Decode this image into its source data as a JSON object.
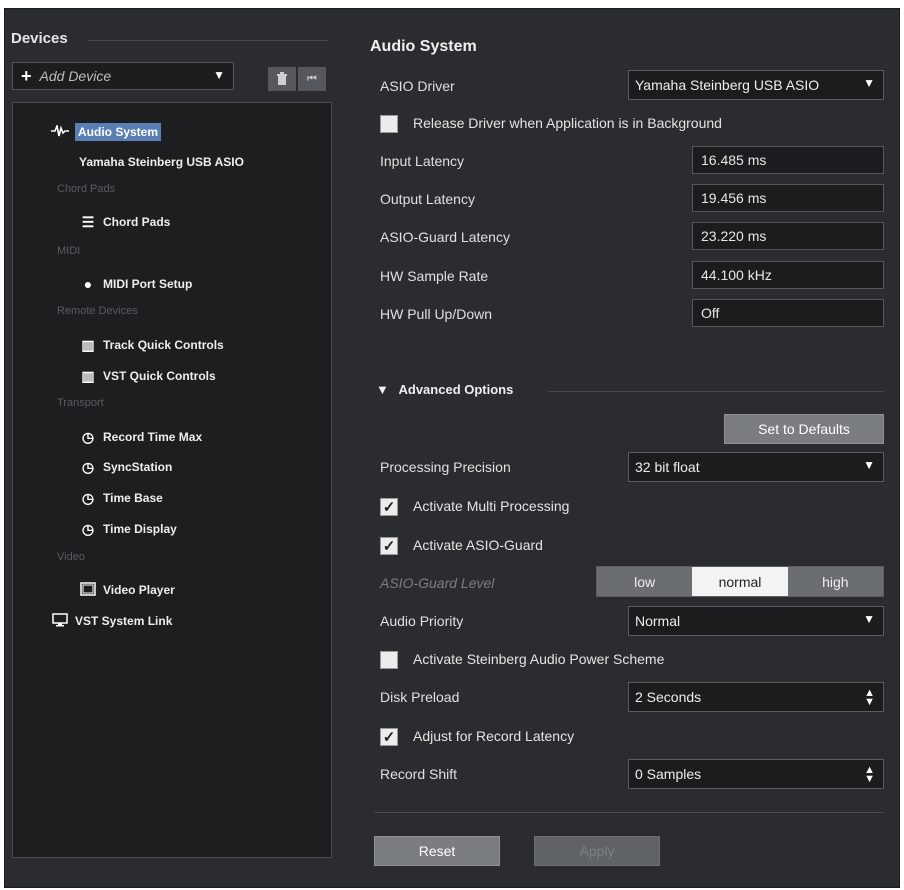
{
  "devices": {
    "title": "Devices",
    "add_device": "Add Device",
    "tree": {
      "audio_system": "Audio System",
      "yamaha": "Yamaha Steinberg USB ASIO",
      "cat_chord_pads": "Chord Pads",
      "chord_pads": "Chord Pads",
      "cat_midi": "MIDI",
      "midi_port_setup": "MIDI Port Setup",
      "cat_remote": "Remote Devices",
      "track_quick_controls": "Track Quick Controls",
      "vst_quick_controls": "VST Quick Controls",
      "cat_transport": "Transport",
      "record_time_max": "Record Time Max",
      "syncstation": "SyncStation",
      "time_base": "Time Base",
      "time_display": "Time Display",
      "cat_video": "Video",
      "video_player": "Video Player",
      "vst_system_link": "VST System Link"
    }
  },
  "audio_system": {
    "title": "Audio System",
    "asio_driver_label": "ASIO Driver",
    "asio_driver_value": "Yamaha Steinberg USB ASIO",
    "release_driver_label": "Release Driver when Application is in Background",
    "input_latency_label": "Input Latency",
    "input_latency_value": "16.485 ms",
    "output_latency_label": "Output Latency",
    "output_latency_value": "19.456 ms",
    "asio_guard_latency_label": "ASIO-Guard Latency",
    "asio_guard_latency_value": "23.220 ms",
    "hw_sample_rate_label": "HW Sample Rate",
    "hw_sample_rate_value": "44.100 kHz",
    "hw_pull_label": "HW Pull Up/Down",
    "hw_pull_value": "Off"
  },
  "advanced": {
    "title": "Advanced Options",
    "set_defaults": "Set to Defaults",
    "processing_precision_label": "Processing Precision",
    "processing_precision_value": "32 bit float",
    "multi_processing_label": "Activate Multi Processing",
    "asio_guard_label": "Activate ASIO-Guard",
    "asio_guard_level_label": "ASIO-Guard Level",
    "level_low": "low",
    "level_normal": "normal",
    "level_high": "high",
    "audio_priority_label": "Audio Priority",
    "audio_priority_value": "Normal",
    "power_scheme_label": "Activate Steinberg Audio Power Scheme",
    "disk_preload_label": "Disk Preload",
    "disk_preload_value": "2 Seconds",
    "adjust_record_label": "Adjust for Record Latency",
    "record_shift_label": "Record Shift",
    "record_shift_value": "0 Samples"
  },
  "footer": {
    "reset": "Reset",
    "apply": "Apply"
  }
}
